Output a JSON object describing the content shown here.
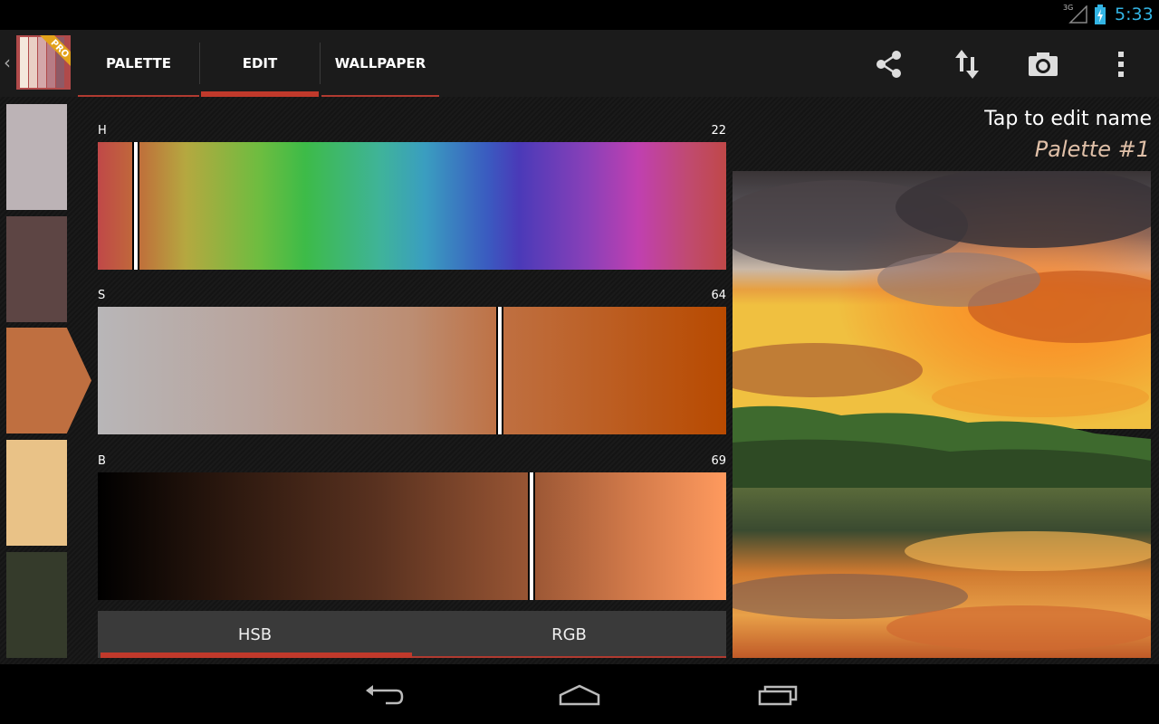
{
  "status_bar": {
    "network": "3G",
    "time": "5:33",
    "clock_color": "#33b5e5"
  },
  "action_bar": {
    "app_icon_badge": "PRO",
    "tabs": [
      {
        "label": "PALETTE",
        "active": false
      },
      {
        "label": "EDIT",
        "active": true
      },
      {
        "label": "WALLPAPER",
        "active": false
      }
    ],
    "actions": [
      "share-icon",
      "swap-vertical-icon",
      "camera-icon",
      "overflow-menu-icon"
    ],
    "accent": "#c0392b"
  },
  "palette": {
    "swatches": [
      {
        "color": "#bcb3b6",
        "selected": false
      },
      {
        "color": "#5d4544",
        "selected": false
      },
      {
        "color": "#bf6f40",
        "selected": true
      },
      {
        "color": "#e9c287",
        "selected": false
      },
      {
        "color": "#353b2b",
        "selected": false
      }
    ]
  },
  "editor": {
    "sliders": [
      {
        "label": "H",
        "value": "22",
        "level": 0.06
      },
      {
        "label": "S",
        "value": "64",
        "level": 0.64
      },
      {
        "label": "B",
        "value": "69",
        "level": 0.69
      }
    ],
    "mode_tabs": [
      {
        "label": "HSB",
        "active": true
      },
      {
        "label": "RGB",
        "active": false
      }
    ]
  },
  "name_panel": {
    "hint": "Tap to edit name",
    "palette_name": "Palette #1",
    "palette_name_color": "#e0c0a8"
  },
  "nav_bar": {
    "buttons": [
      "back-icon",
      "home-icon",
      "recent-apps-icon"
    ]
  }
}
